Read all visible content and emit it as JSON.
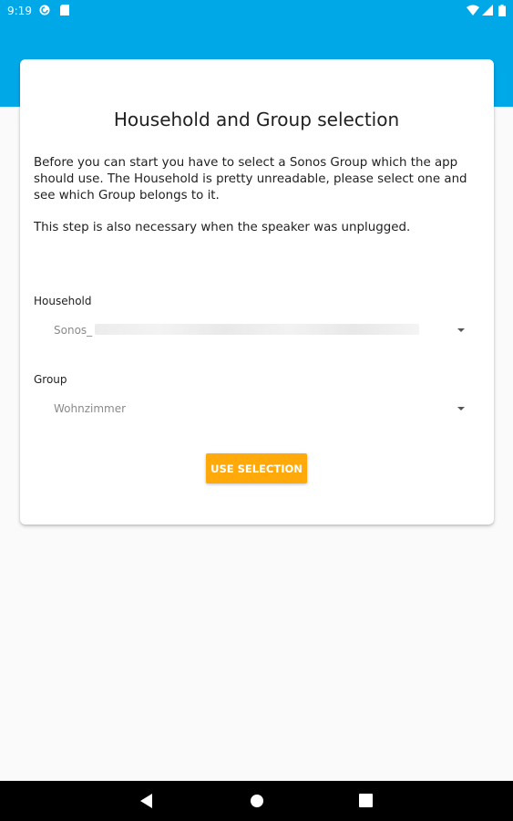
{
  "status_bar": {
    "time": "9:19"
  },
  "card": {
    "title": "Household and Group selection",
    "description": [
      "Before you can start you have to select a Sonos Group which the app should use. The Household is pretty unreadable, please select one and see which Group belongs to it.",
      "This step is also necessary when the speaker was unplugged."
    ],
    "household": {
      "label": "Household",
      "value": "Sonos_"
    },
    "group": {
      "label": "Group",
      "value": "Wohnzimmer"
    },
    "button_label": "USE SELECTION"
  },
  "colors": {
    "primary": "#00a8e8",
    "accent": "#ffa90a"
  },
  "icons": {
    "status_left": [
      "pocket-casts-icon",
      "sim-card-icon"
    ],
    "status_right": [
      "wifi-icon",
      "signal-icon",
      "battery-icon"
    ],
    "nav": [
      "back-icon",
      "home-icon",
      "recents-icon"
    ]
  }
}
